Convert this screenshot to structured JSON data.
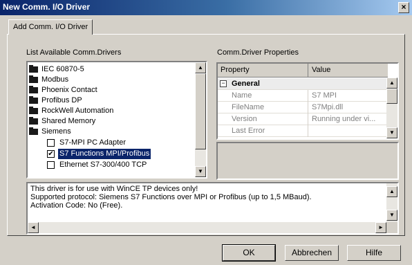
{
  "window": {
    "title": "New Comm. I/O Driver",
    "close_glyph": "×"
  },
  "tab": {
    "label": "Add Comm. I/O Driver"
  },
  "drivers": {
    "label": "List Available Comm.Drivers",
    "folders": [
      "IEC 60870-5",
      "Modbus",
      "Phoenix Contact",
      "Profibus DP",
      "RockWell Automation",
      "Shared Memory",
      "Siemens"
    ],
    "siemens_children": [
      {
        "label": "S7-MPI PC Adapter",
        "checked": false,
        "selected": false
      },
      {
        "label": "S7 Functions MPI/Profibus",
        "checked": true,
        "selected": true
      },
      {
        "label": "Ethernet S7-300/400 TCP",
        "checked": false,
        "selected": false
      }
    ]
  },
  "properties": {
    "label": "Comm.Driver Properties",
    "col_property": "Property",
    "col_value": "Value",
    "category": "General",
    "category_expander": "−",
    "rows": [
      {
        "name": "Name",
        "value": "S7 MPI"
      },
      {
        "name": "FileName",
        "value": "S7Mpi.dll"
      },
      {
        "name": "Version",
        "value": "Running under vi..."
      },
      {
        "name": "Last Error",
        "value": ""
      }
    ]
  },
  "info": {
    "lines": [
      "This driver is for use with WinCE TP devices only!",
      "Supported protocol: Siemens S7 Functions over MPI or Profibus (up to 1,5 MBaud).",
      "Activation Code: No (Free)."
    ]
  },
  "buttons": {
    "ok": "OK",
    "cancel": "Abbrechen",
    "help": "Hilfe"
  },
  "scroll_glyphs": {
    "up": "▲",
    "down": "▼",
    "left": "◄",
    "right": "►"
  },
  "colors": {
    "selection": "#0a246a",
    "titlebar_start": "#0a246a",
    "dialog_face": "#d4d0c8"
  }
}
